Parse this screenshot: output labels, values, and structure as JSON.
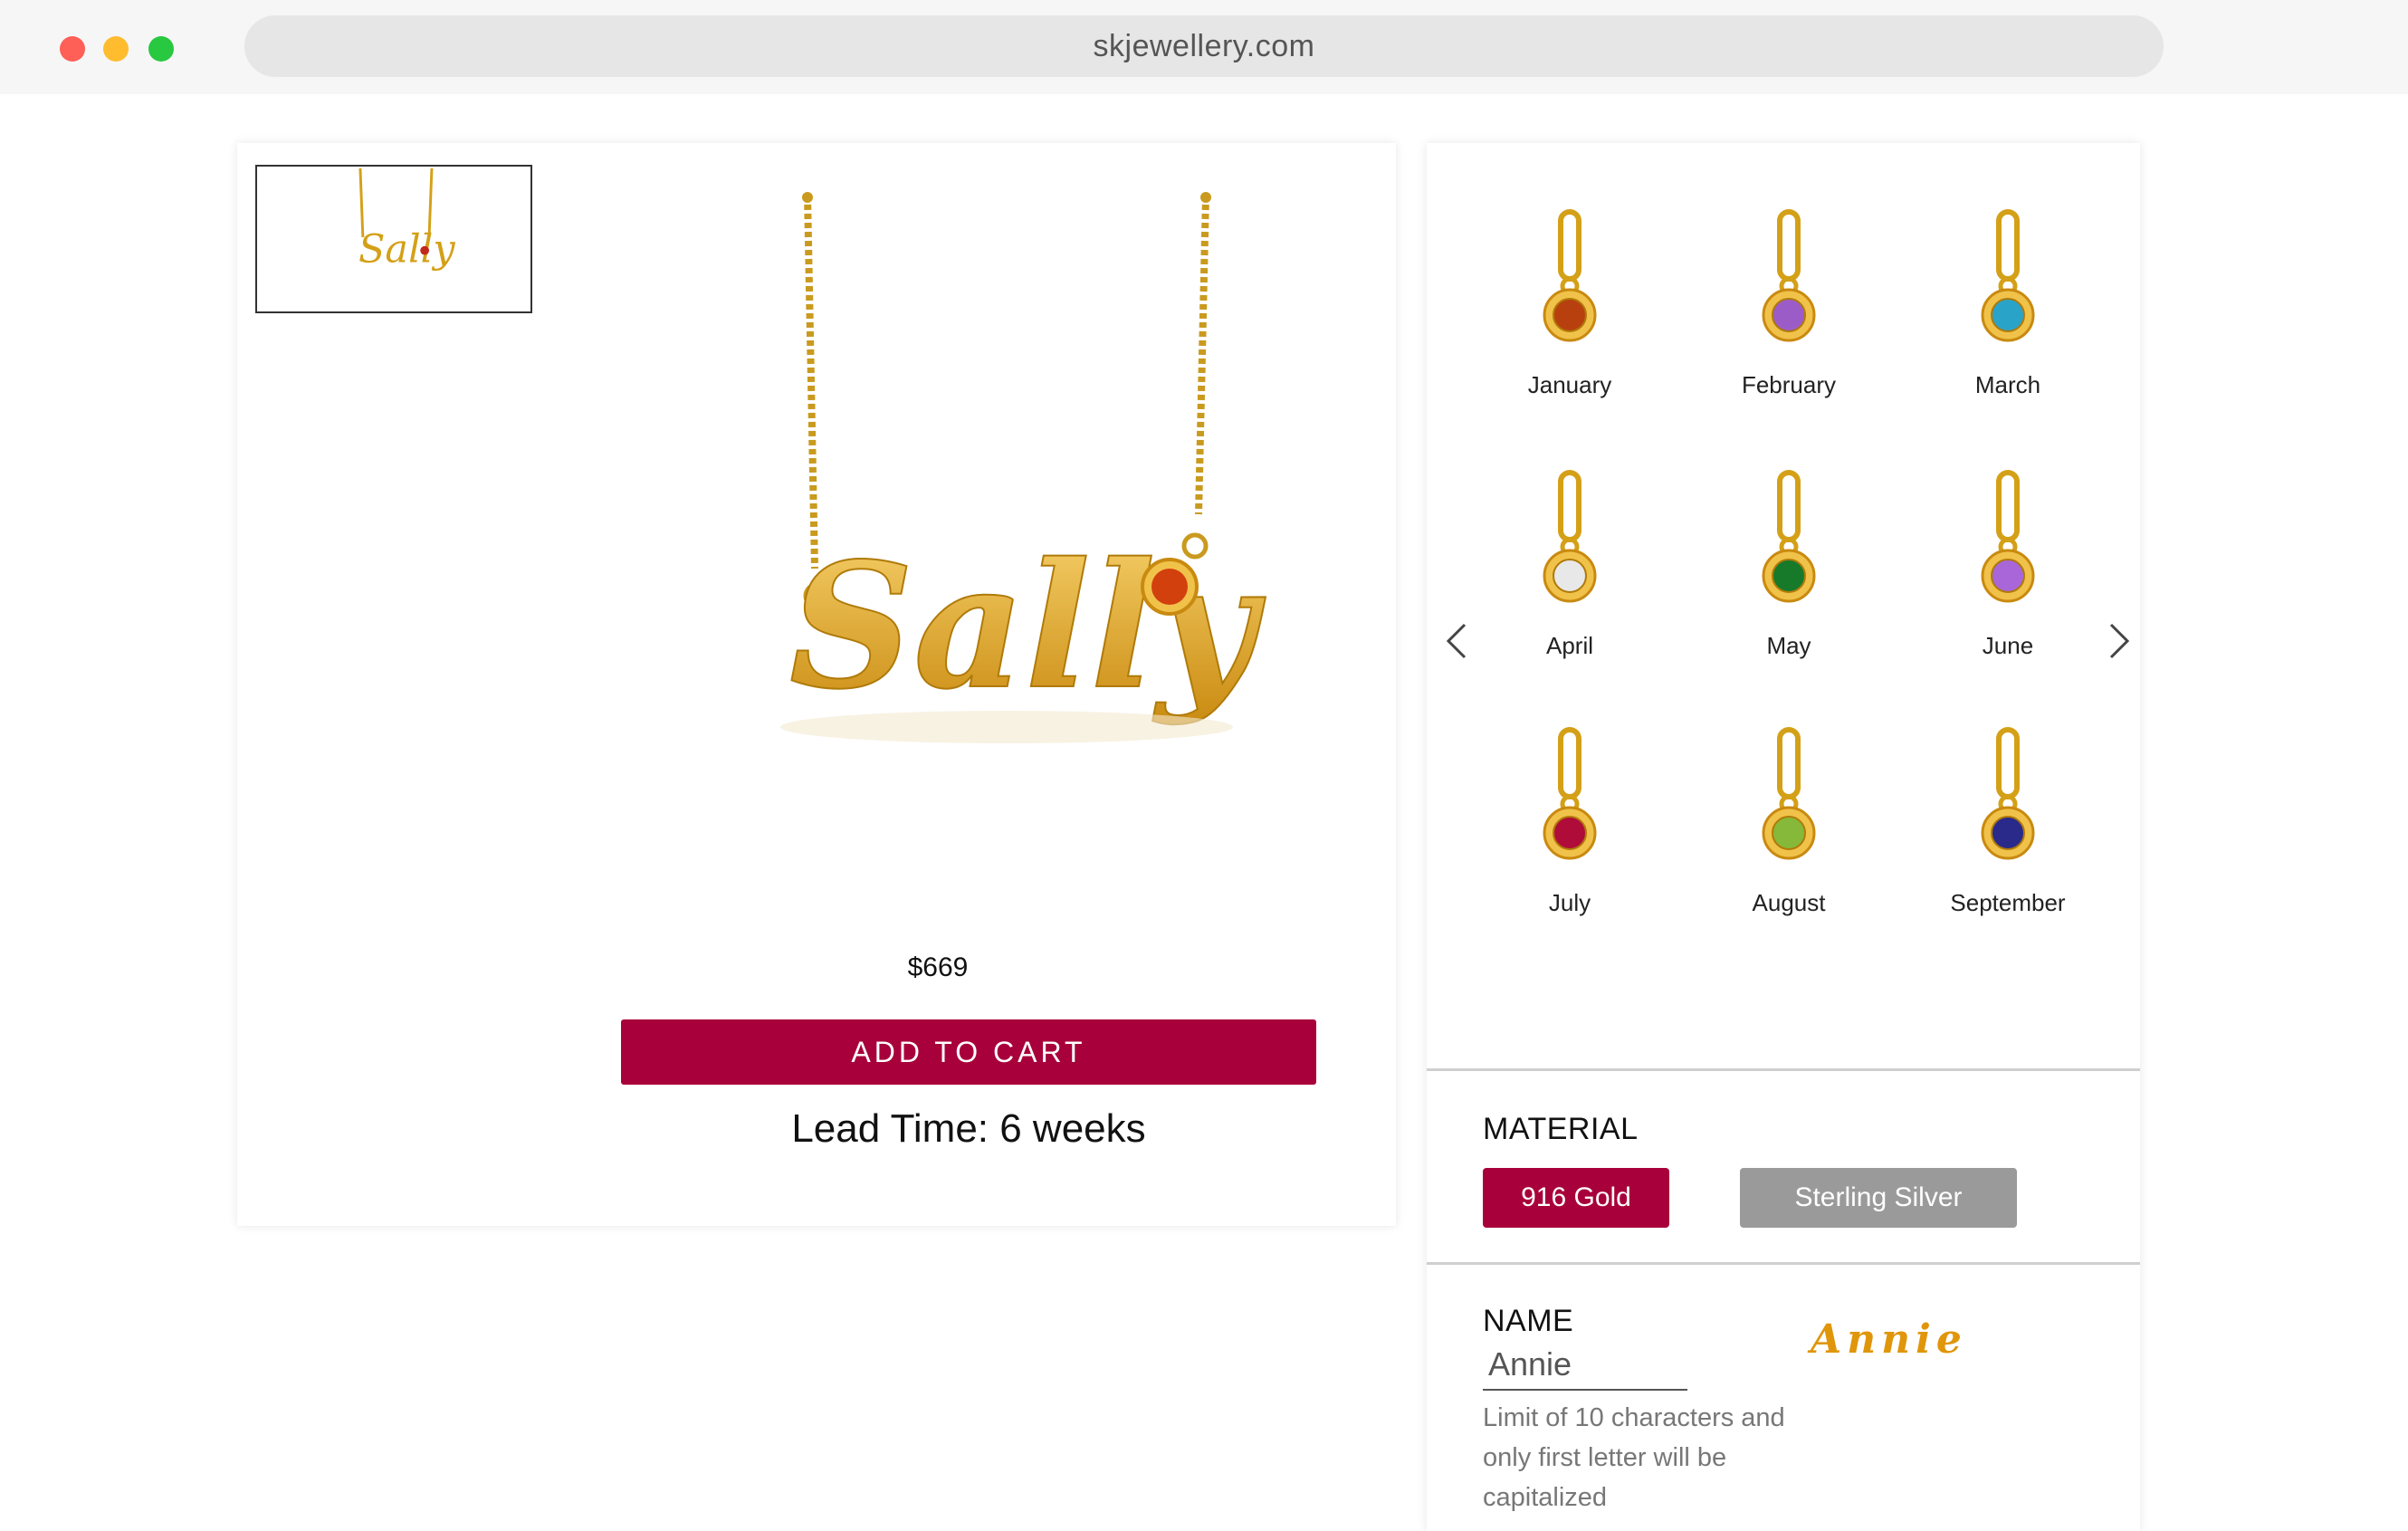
{
  "browser": {
    "url": "skjewellery.com"
  },
  "product": {
    "price": "$669",
    "add_to_cart_label": "ADD TO CART",
    "lead_time": "Lead Time: 6 weeks",
    "preview_name": "Sally"
  },
  "birthstones": [
    {
      "label": "January",
      "color": "#b8400f"
    },
    {
      "label": "February",
      "color": "#9c5cc8"
    },
    {
      "label": "March",
      "color": "#2aa3c9"
    },
    {
      "label": "April",
      "color": "#e8e8e8"
    },
    {
      "label": "May",
      "color": "#167a2a"
    },
    {
      "label": "June",
      "color": "#a866d8"
    },
    {
      "label": "July",
      "color": "#b00c3a"
    },
    {
      "label": "August",
      "color": "#86b83a"
    },
    {
      "label": "September",
      "color": "#2a2a8a"
    }
  ],
  "material": {
    "label": "MATERIAL",
    "options": [
      "916 Gold",
      "Sterling Silver"
    ],
    "selected": "916 Gold"
  },
  "name_field": {
    "label": "NAME",
    "value": "Annie",
    "preview": "Annie",
    "hint": "Limit of 10 characters and only first letter will be capitalized"
  },
  "colors": {
    "accent": "#a8003a",
    "gold": "#e0960a",
    "silver_button": "#9a9a9a"
  },
  "icons": {
    "prev": "chevron-left-icon",
    "next": "chevron-right-icon"
  }
}
